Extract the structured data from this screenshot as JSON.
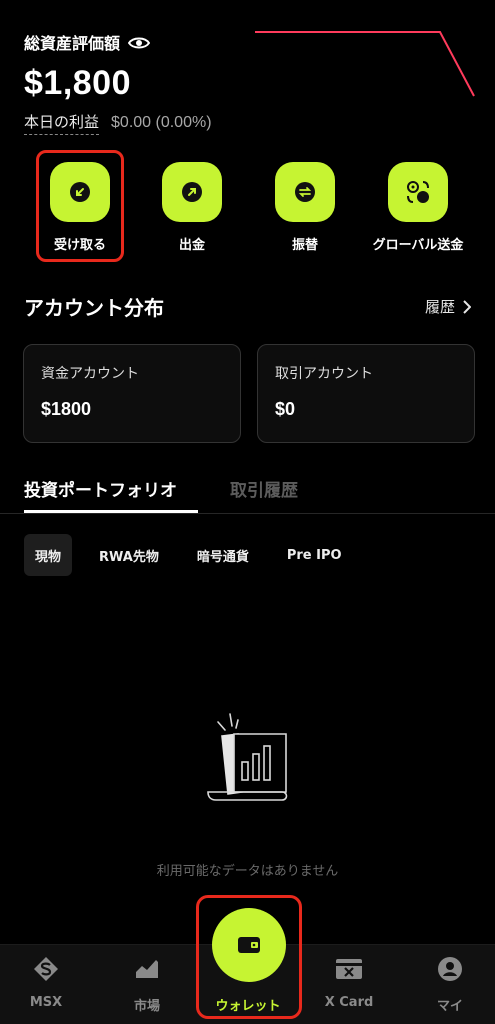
{
  "header": {
    "total_label": "総資産評価額",
    "total_value": "$1,800",
    "pnl_label": "本日の利益",
    "pnl_value": "$0.00 (0.00%)"
  },
  "actions": [
    {
      "label": "受け取る",
      "icon": "receive-arrow-icon"
    },
    {
      "label": "出金",
      "icon": "withdraw-arrow-icon"
    },
    {
      "label": "振替",
      "icon": "transfer-icon"
    },
    {
      "label": "グローバル送金",
      "icon": "global-transfer-icon"
    }
  ],
  "distribution": {
    "title": "アカウント分布",
    "history_label": "履歴"
  },
  "accounts": [
    {
      "name": "資金アカウント",
      "amount": "$1800"
    },
    {
      "name": "取引アカウント",
      "amount": "$0"
    }
  ],
  "tabs": [
    {
      "label": "投資ポートフォリオ",
      "active": true
    },
    {
      "label": "取引履歴",
      "active": false
    }
  ],
  "chips": [
    {
      "label": "現物",
      "active": true
    },
    {
      "label": "RWA先物",
      "active": false
    },
    {
      "label": "暗号通貨",
      "active": false
    },
    {
      "label": "Pre IPO",
      "active": false
    }
  ],
  "empty_state": {
    "message": "利用可能なデータはありません"
  },
  "nav": [
    {
      "label": "MSX",
      "icon": "msx-logo-icon",
      "active": false
    },
    {
      "label": "市場",
      "icon": "market-chart-icon",
      "active": false
    },
    {
      "label": "ウォレット",
      "icon": "wallet-icon",
      "active": true
    },
    {
      "label": "X Card",
      "icon": "card-icon",
      "active": false
    },
    {
      "label": "マイ",
      "icon": "profile-icon",
      "active": false
    }
  ],
  "colors": {
    "accent": "#c6f432",
    "highlight": "#e8291c",
    "background": "#000000"
  }
}
